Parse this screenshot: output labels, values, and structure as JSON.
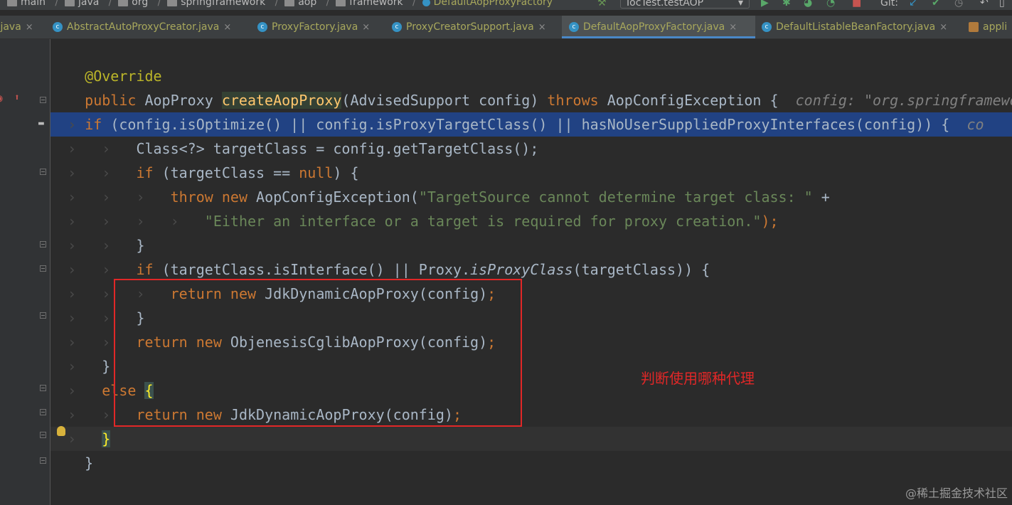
{
  "breadcrumb": {
    "items": [
      "main",
      "java",
      "org",
      "springframework",
      "aop",
      "framework",
      "DefaultAopProxyFactory"
    ]
  },
  "toolbar": {
    "run_config": "IocTest.testAOP",
    "git_label": "Git:"
  },
  "tabs": [
    {
      "label": ".java",
      "active": false
    },
    {
      "label": "AbstractAutoProxyCreator.java",
      "active": false
    },
    {
      "label": "ProxyFactory.java",
      "active": false
    },
    {
      "label": "ProxyCreatorSupport.java",
      "active": false
    },
    {
      "label": "DefaultAopProxyFactory.java",
      "active": true
    },
    {
      "label": "DefaultListableBeanFactory.java",
      "active": false
    },
    {
      "label": "appli",
      "active": false
    }
  ],
  "tab_close_glyph": "×",
  "code": {
    "l1_ann": "@Override",
    "l2_public": "public ",
    "l2_type": "AopProxy ",
    "l2_method": "createAopProxy",
    "l2_params": "(AdvisedSupport config) ",
    "l2_throws": "throws ",
    "l2_exc": "AopConfigException {",
    "l2_hint": "config: \"org.springframework",
    "l3_if": "if ",
    "l3_cond": "(config.isOptimize() || config.isProxyTargetClass() || hasNoUserSuppliedProxyInterfaces(config)) {",
    "l3_hint": "co",
    "l4": "Class<?> targetClass = config.getTargetClass();",
    "l5_if": "if ",
    "l5_a": "(targetClass == ",
    "l5_null": "null",
    "l5_b": ") {",
    "l6_throw": "throw ",
    "l6_new": "new ",
    "l6_a": "AopConfigException(",
    "l6_str": "\"TargetSource cannot determine target class: \"",
    "l6_b": " +",
    "l7_str": "\"Either an interface or a target is required for proxy creation.\"",
    "l7_b": ");",
    "l8": "}",
    "l9_if": "if ",
    "l9_a": "(targetClass.isInterface() || Proxy.",
    "l9_method": "isProxyClass",
    "l9_b": "(targetClass)) {",
    "l10_return": "return ",
    "l10_new": "new ",
    "l10_a": "JdkDynamicAopProxy(config)",
    "l10_semi": ";",
    "l11": "}",
    "l12_return": "return ",
    "l12_new": "new ",
    "l12_a": "ObjenesisCglibAopProxy(config)",
    "l12_semi": ";",
    "l13": "}",
    "l14_else": "else ",
    "l14_brace": "{",
    "l15_return": "return ",
    "l15_new": "new ",
    "l15_a": "JdkDynamicAopProxy(config)",
    "l15_semi": ";",
    "l16_brace": "}",
    "l17": "}"
  },
  "annotation_note": "判断使用哪种代理",
  "watermark": "@稀土掘金技术社区",
  "colors": {
    "keyword": "#cc7832",
    "string": "#6a8759",
    "annotation": "#bbb529",
    "method": "#ffc66d",
    "selection": "#214283",
    "red_box": "#e12727"
  }
}
